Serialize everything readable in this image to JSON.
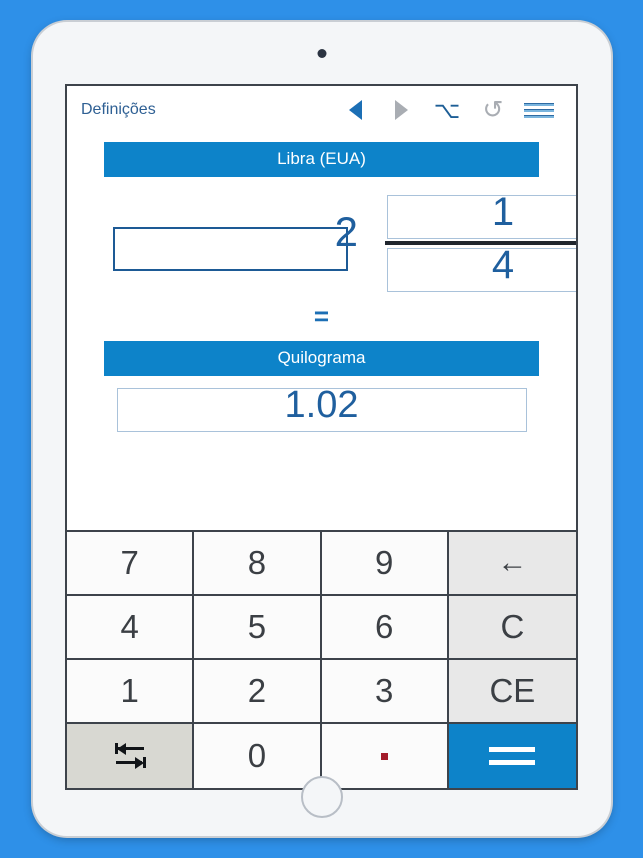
{
  "app": {
    "toolbar": {
      "settings_label": "Definições",
      "back_icon": "triangle-left-icon",
      "forward_icon": "triangle-right-icon",
      "option_icon": "⌥",
      "undo_icon": "↺",
      "menu_icon": "hamburger-menu-icon"
    },
    "conversion": {
      "from_unit": "Libra (EUA)",
      "to_unit": "Quilograma",
      "equals_symbol": "=",
      "whole_value": "2",
      "numerator": "1",
      "denominator": "4",
      "result_value": "1.02"
    },
    "keypad": {
      "rows": [
        [
          {
            "label": "7",
            "type": "digit"
          },
          {
            "label": "8",
            "type": "digit"
          },
          {
            "label": "9",
            "type": "digit"
          },
          {
            "label": "←",
            "type": "fn",
            "name": "backspace"
          }
        ],
        [
          {
            "label": "4",
            "type": "digit"
          },
          {
            "label": "5",
            "type": "digit"
          },
          {
            "label": "6",
            "type": "digit"
          },
          {
            "label": "C",
            "type": "fn",
            "name": "clear"
          }
        ],
        [
          {
            "label": "1",
            "type": "digit"
          },
          {
            "label": "2",
            "type": "digit"
          },
          {
            "label": "3",
            "type": "digit"
          },
          {
            "label": "CE",
            "type": "fn",
            "name": "clear-entry"
          }
        ],
        [
          {
            "label": "",
            "type": "swap",
            "name": "swap-units"
          },
          {
            "label": "0",
            "type": "digit"
          },
          {
            "label": ".",
            "type": "dot",
            "name": "decimal-point"
          },
          {
            "label": "=",
            "type": "equals",
            "name": "equals"
          }
        ]
      ]
    },
    "colors": {
      "background": "#2e90e8",
      "accent_blue": "#0d83c9",
      "text_blue": "#1f5f9e",
      "function_key": "#e8e8e8",
      "swap_key": "#d8d8d2",
      "decimal_dot": "#a31b2a"
    }
  }
}
